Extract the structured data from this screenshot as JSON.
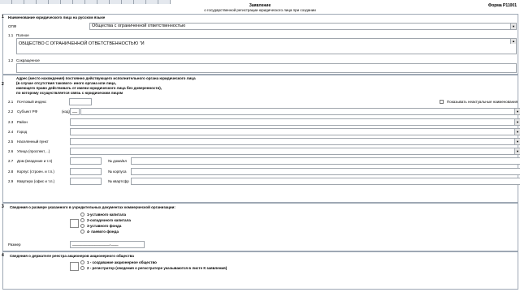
{
  "header": {
    "title": "Заявление",
    "subtitle": "о государственной регистрации юридического лица при создании",
    "form_label": "Форма Р11001"
  },
  "section1": {
    "number": "1",
    "heading": "Наименование юридического лица на русском языке",
    "opf": {
      "label": "ОПФ",
      "value": "Общества с ограниченной ответственностью"
    },
    "full": {
      "number": "1.1",
      "label": "Полное",
      "value": "ОБЩЕСТВО С ОГРАНИЧЕННОЙ ОТВЕТСТВЕННОСТЬЮ \"И"
    },
    "short": {
      "number": "1.2",
      "label": "Сокращенное",
      "value": ""
    }
  },
  "section2": {
    "number": "2",
    "heading_lines": [
      "Адрес (место нахождения) постоянно действующего исполнительного органа юридического лица",
      "(в случае отсутствия такового- иного органа или лица,",
      "имеющего право действовать от имени юридического лица без доверенности),",
      "по которому осуществляется связь с юридическим лицом"
    ],
    "checkbox_label": "Показывать неактуальные наименования",
    "fields": [
      {
        "number": "2.1",
        "label": "Почтовый индекс"
      },
      {
        "number": "2.2",
        "label": "Субъект РФ",
        "code_label": "(код)",
        "code_value": "__"
      },
      {
        "number": "2.3",
        "label": "Район"
      },
      {
        "number": "2.4",
        "label": "Город"
      },
      {
        "number": "2.5",
        "label": "Населенный пункт"
      },
      {
        "number": "2.6",
        "label": "Улица (проспект, ..)"
      },
      {
        "number": "2.7",
        "label": "Дом (владение и т.п)",
        "right_label": "№ дома/вл"
      },
      {
        "number": "2.8",
        "label": "Корпус (строен. и т.п.)",
        "right_label": "№ корпуса"
      },
      {
        "number": "2.9",
        "label": "Квартира (офис и т.п.)",
        "right_label": "№ квартсфр"
      }
    ]
  },
  "section3": {
    "number": "3",
    "heading": "Сведения о размере указанного в учредительных документах коммерческой организации:",
    "options": [
      "1-уставного капитала",
      "2-складочного капитала",
      "3-уставного фонда",
      "4- паевого фонда"
    ],
    "size_label": "Размер",
    "size_value": "_______________,___"
  },
  "section4": {
    "number": "4",
    "heading": "Сведения о держателе реестра акционеров акционерного общества",
    "options": [
      "1 - создавание акционерное общество",
      "2 - регистратор (сведения о регистраторе указываются в листе К заявления)"
    ]
  }
}
